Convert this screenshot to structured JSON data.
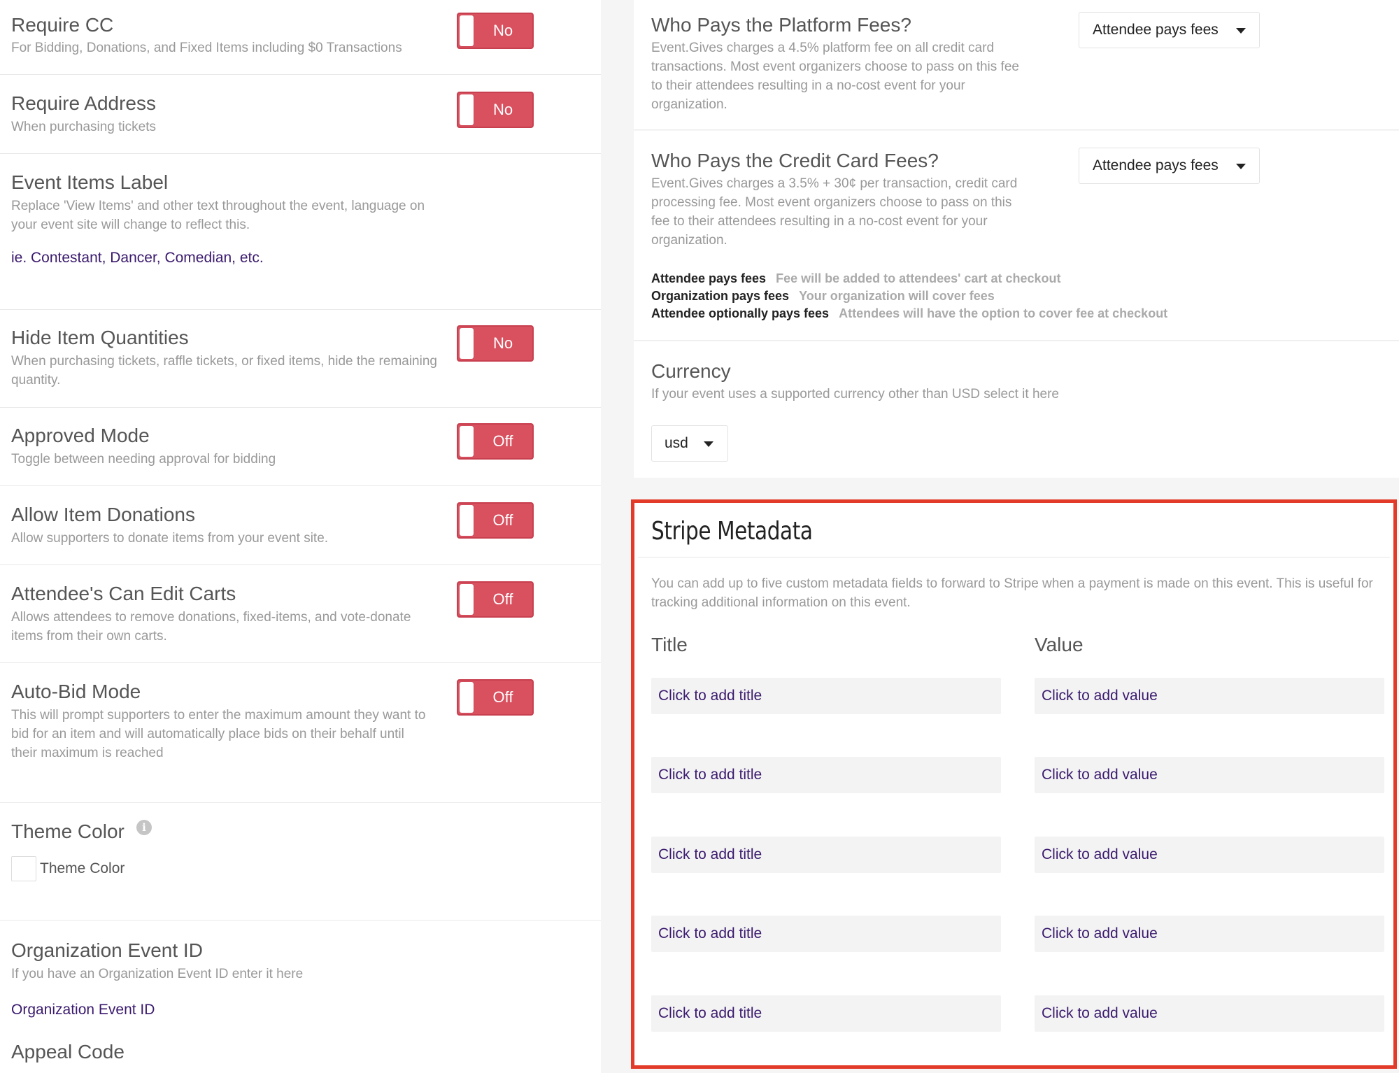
{
  "settings": {
    "require_cc": {
      "title": "Require CC",
      "subtitle": "For Bidding, Donations, and Fixed Items including $0 Transactions",
      "toggle": "No"
    },
    "require_address": {
      "title": "Require Address",
      "subtitle": "When purchasing tickets",
      "toggle": "No"
    },
    "event_items_label": {
      "title": "Event Items Label",
      "subtitle": "Replace 'View Items' and other text throughout the event, language on your event site will change to reflect this.",
      "placeholder": "ie. Contestant, Dancer, Comedian, etc."
    },
    "hide_item_quantities": {
      "title": "Hide Item Quantities",
      "subtitle": "When purchasing tickets, raffle tickets, or fixed items, hide the remaining quantity.",
      "toggle": "No"
    },
    "approved_mode": {
      "title": "Approved Mode",
      "subtitle": "Toggle between needing approval for bidding",
      "toggle": "Off"
    },
    "allow_item_donations": {
      "title": "Allow Item Donations",
      "subtitle": "Allow supporters to donate items from your event site.",
      "toggle": "Off"
    },
    "attendees_edit_carts": {
      "title": "Attendee's Can Edit Carts",
      "subtitle": "Allows attendees to remove donations, fixed-items, and vote-donate items from their own carts.",
      "toggle": "Off"
    },
    "auto_bid_mode": {
      "title": "Auto-Bid Mode",
      "subtitle": "This will prompt supporters to enter the maximum amount they want to bid for an item and will automatically place bids on their behalf until their maximum is reached",
      "toggle": "Off"
    },
    "theme_color": {
      "title": "Theme Color",
      "info_icon": "i",
      "swatch_label": "Theme Color"
    },
    "org_event_id": {
      "title": "Organization Event ID",
      "subtitle": "If you have an Organization Event ID enter it here",
      "placeholder": "Organization Event ID"
    },
    "appeal_code": {
      "title": "Appeal Code"
    }
  },
  "fees": {
    "platform": {
      "title": "Who Pays the Platform Fees?",
      "subtitle": "Event.Gives charges a 4.5% platform fee on all credit card transactions. Most event organizers choose to pass on this fee to their attendees resulting in a no-cost event for your organization.",
      "selected": "Attendee pays fees"
    },
    "credit_card": {
      "title": "Who Pays the Credit Card Fees?",
      "subtitle": "Event.Gives charges a 3.5% + 30¢ per transaction, credit card processing fee. Most event organizers choose to pass on this fee to their attendees resulting in a no-cost event for your organization.",
      "selected": "Attendee pays fees"
    },
    "legend": [
      {
        "option": "Attendee pays fees",
        "desc": "Fee will be added to attendees' cart at checkout"
      },
      {
        "option": "Organization pays fees",
        "desc": "Your organization will cover fees"
      },
      {
        "option": "Attendee optionally pays fees",
        "desc": "Attendees will have the option to cover fee at checkout"
      }
    ]
  },
  "currency": {
    "title": "Currency",
    "subtitle": "If your event uses a supported currency other than USD select it here",
    "selected": "usd"
  },
  "stripe": {
    "title": "Stripe Metadata",
    "description": "You can add up to five custom metadata fields to forward to Stripe when a payment is made on this event. This is useful for tracking additional information on this event.",
    "title_header": "Title",
    "value_header": "Value",
    "rows": [
      {
        "title_placeholder": "Click to add title",
        "value_placeholder": "Click to add value"
      },
      {
        "title_placeholder": "Click to add title",
        "value_placeholder": "Click to add value"
      },
      {
        "title_placeholder": "Click to add title",
        "value_placeholder": "Click to add value"
      },
      {
        "title_placeholder": "Click to add title",
        "value_placeholder": "Click to add value"
      },
      {
        "title_placeholder": "Click to add title",
        "value_placeholder": "Click to add value"
      }
    ]
  },
  "colors": {
    "toggle_red": "#d9505f",
    "highlight_border": "#e23b2a",
    "placeholder_purple": "#3a1a6e"
  },
  "icons": {
    "info": "info-icon",
    "caret": "caret-down-icon"
  }
}
